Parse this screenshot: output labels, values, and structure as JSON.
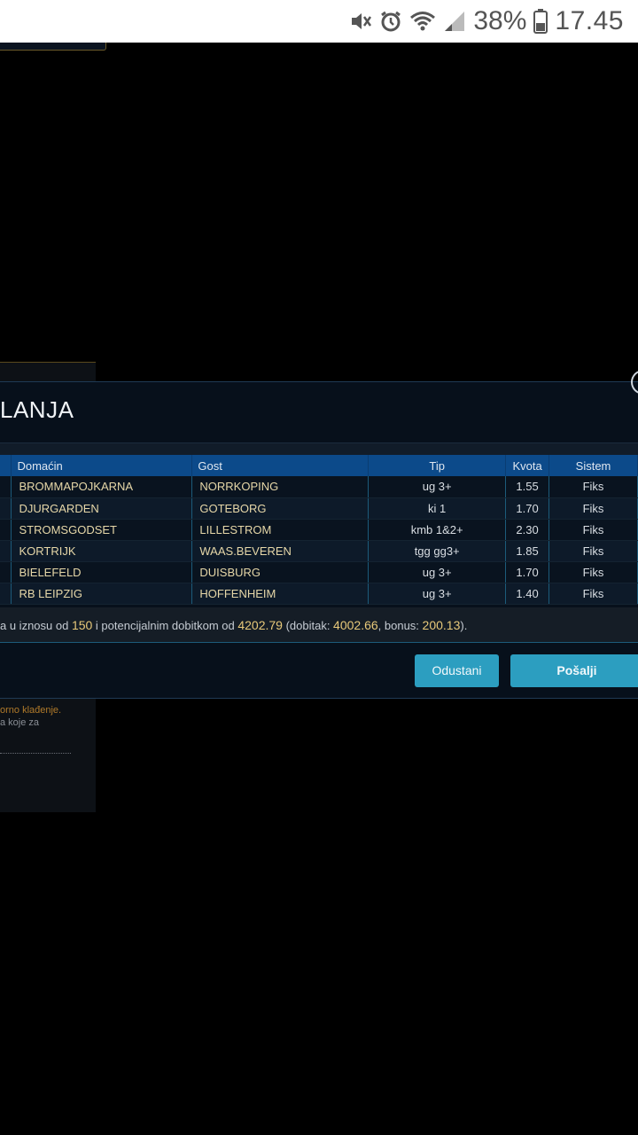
{
  "status_bar": {
    "battery_percent": "38%",
    "time": "17.45",
    "icons": [
      "mute-icon",
      "alarm-icon",
      "wifi-icon",
      "signal-icon",
      "battery-icon"
    ]
  },
  "background": {
    "note_line1": "orno klađenje.",
    "note_line2": "a koje za"
  },
  "modal": {
    "title": "LANJA",
    "columns": {
      "home": "Domaćin",
      "guest": "Gost",
      "tip": "Tip",
      "odds": "Kvota",
      "system": "Sistem"
    },
    "rows": [
      {
        "home": "BROMMAPOJKARNA",
        "guest": "NORRKOPING",
        "tip": "ug 3+",
        "odds": "1.55",
        "system": "Fiks"
      },
      {
        "home": "DJURGARDEN",
        "guest": "GOTEBORG",
        "tip": "ki 1",
        "odds": "1.70",
        "system": "Fiks"
      },
      {
        "home": "STROMSGODSET",
        "guest": "LILLESTROM",
        "tip": "kmb 1&2+",
        "odds": "2.30",
        "system": "Fiks"
      },
      {
        "home": "KORTRIJK",
        "guest": "WAAS.BEVEREN",
        "tip": "tgg gg3+",
        "odds": "1.85",
        "system": "Fiks"
      },
      {
        "home": "BIELEFELD",
        "guest": "DUISBURG",
        "tip": "ug 3+",
        "odds": "1.70",
        "system": "Fiks"
      },
      {
        "home": "RB LEIPZIG",
        "guest": "HOFFENHEIM",
        "tip": "ug 3+",
        "odds": "1.40",
        "system": "Fiks"
      }
    ],
    "summary": {
      "part1": "a u iznosu od ",
      "stake": "150",
      "part2": " i potencijalnim dobitkom od ",
      "potential": "4202.79",
      "part3": " (dobitak: ",
      "win": "4002.66",
      "part4": ", bonus: ",
      "bonus": "200.13",
      "part5": ")."
    },
    "buttons": {
      "cancel": "Odustani",
      "send": "Pošalji"
    }
  },
  "colors": {
    "header_blue": "#0c4a8a",
    "button": "#2c9ec0",
    "highlight": "#e8c97a"
  }
}
